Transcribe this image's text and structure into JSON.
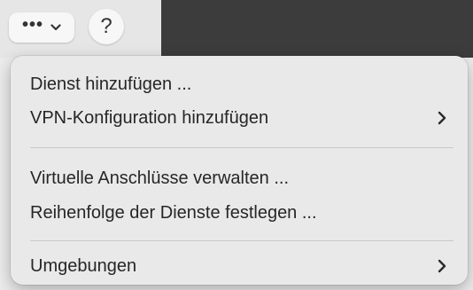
{
  "toolbar": {
    "more_button_glyph": "•••",
    "more_button_icon": "chevron-down-icon",
    "help_label": "?"
  },
  "menu": {
    "items": [
      {
        "label": "Dienst hinzufügen ...",
        "has_submenu": false
      },
      {
        "label": "VPN-Konfiguration hinzufügen",
        "has_submenu": true
      },
      {
        "label": "Virtuelle Anschlüsse verwalten ...",
        "has_submenu": false
      },
      {
        "label": "Reihenfolge der Dienste festlegen ...",
        "has_submenu": false
      },
      {
        "label": "Umgebungen",
        "has_submenu": true
      }
    ]
  },
  "colors": {
    "menu_background": "#e9e9e9",
    "text": "#262626",
    "window_dark": "#3c3c3c"
  }
}
